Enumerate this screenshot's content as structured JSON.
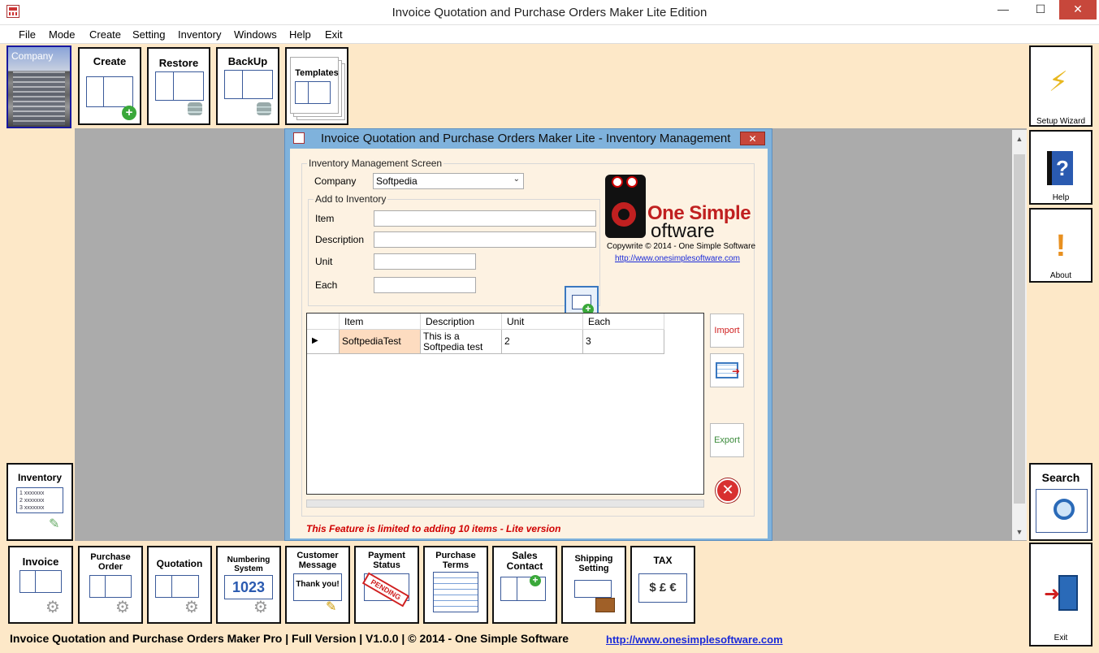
{
  "window": {
    "title": "Invoice Quotation and Purchase Orders Maker Lite Edition",
    "min": "—",
    "max": "☐",
    "close": "✕"
  },
  "menu": [
    "File",
    "Mode",
    "Create",
    "Setting",
    "Inventory",
    "Windows",
    "Help",
    "Exit"
  ],
  "toolbar": {
    "company": "Company",
    "create": "Create",
    "restore": "Restore",
    "backup": "BackUp",
    "templates": "Templates"
  },
  "side": {
    "inventory": "Inventory",
    "inventory_lines": [
      "1  xxxxxxx",
      "2  xxxxxxx",
      "3  xxxxxxx"
    ],
    "setup_wizard": "Setup Wizard",
    "help": "Help",
    "about": "About",
    "search": "Search",
    "exit": "Exit"
  },
  "dialog": {
    "title": "Invoice Quotation and Purchase Orders Maker Lite - Inventory Management",
    "close": "✕",
    "group_title": "Inventory Management Screen",
    "company_label": "Company",
    "company_value": "Softpedia",
    "add_group": "Add to Inventory",
    "item_label": "Item",
    "description_label": "Description",
    "unit_label": "Unit",
    "each_label": "Each",
    "logo_line1": "One Simple",
    "logo_line2": "oftware",
    "copyright": "Copywrite © 2014 - One Simple Software",
    "url": "http://www.onesimplesoftware.com",
    "import": "Import",
    "export": "Export",
    "limit_note": "This Feature is limited to adding 10 items - Lite version"
  },
  "grid": {
    "columns": [
      "Item",
      "Description",
      "Unit",
      "Each"
    ],
    "rows": [
      {
        "marker": "▶",
        "item": "SoftpediaTest",
        "description": "This is a Softpedia test",
        "unit": "2",
        "each": "3"
      }
    ]
  },
  "bottom": {
    "invoice": "Invoice",
    "purchase_order": "Purchase Order",
    "quotation": "Quotation",
    "numbering_system": "Numbering System",
    "numbering_digits": "1023",
    "customer_message": "Customer Message",
    "thank_you": "Thank you!",
    "payment_status": "Payment Status",
    "pending": "PENDING",
    "purchase_terms": "Purchase Terms",
    "sales_contact": "Sales Contact",
    "shipping_setting": "Shipping Setting",
    "tax": "TAX",
    "tax_symbols": "$ £ €"
  },
  "footer": {
    "text": "Invoice Quotation and Purchase Orders Maker Pro  |  Full Version  |  V1.0.0  |  © 2014 - One Simple Software",
    "url": "http://www.onesimplesoftware.com"
  },
  "colors": {
    "background": "#fde8c8",
    "accent_blue": "#1a2ad8",
    "warning_red": "#d00000",
    "close_red": "#c7473b"
  }
}
